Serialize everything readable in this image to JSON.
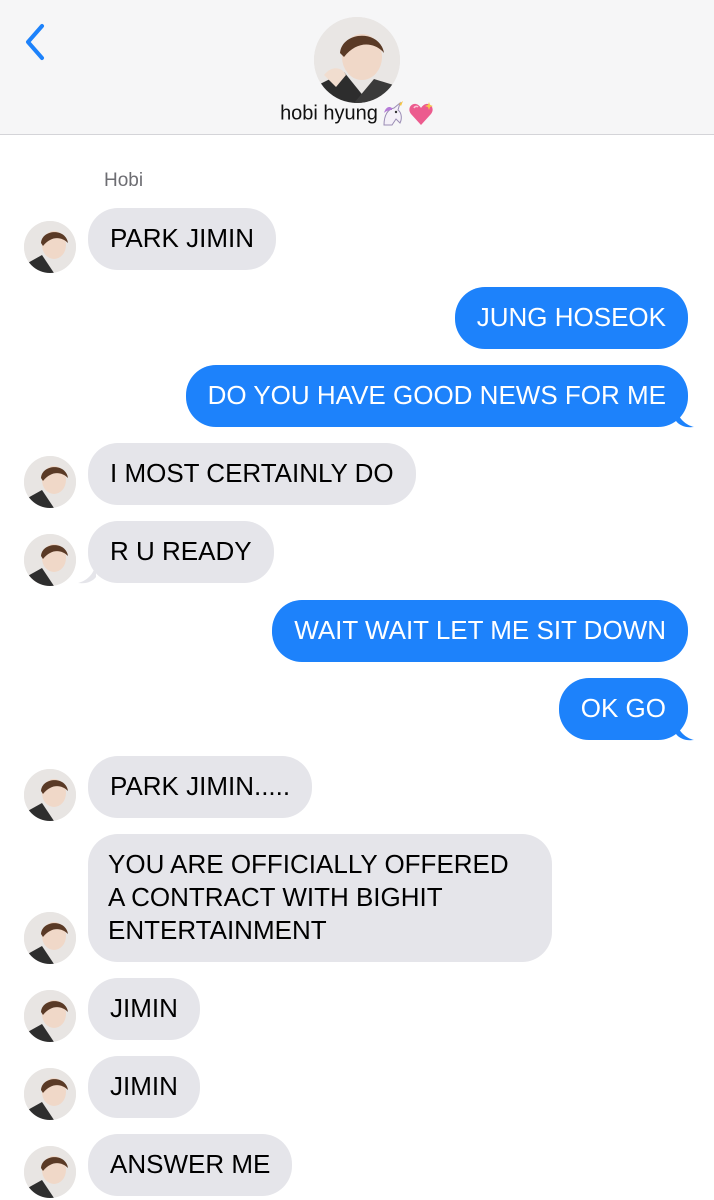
{
  "header": {
    "contact_name": "hobi hyung",
    "emoji_1": "unicorn-icon",
    "emoji_2": "sparkling-heart-icon",
    "back_icon": "chevron-left-icon"
  },
  "thread": {
    "sender_label": "Hobi",
    "messages": [
      {
        "from": "them",
        "text": "PARK JIMIN"
      },
      {
        "from": "me",
        "text": "JUNG HOSEOK"
      },
      {
        "from": "me",
        "text": "DO YOU HAVE GOOD NEWS FOR ME"
      },
      {
        "from": "them",
        "text": "I MOST CERTAINLY DO"
      },
      {
        "from": "them",
        "text": "R U READY"
      },
      {
        "from": "me",
        "text": "WAIT WAIT LET ME SIT DOWN"
      },
      {
        "from": "me",
        "text": "OK GO"
      },
      {
        "from": "them",
        "text": "PARK JIMIN....."
      },
      {
        "from": "them",
        "text": "YOU ARE OFFICIALLY OFFERED A CONTRACT WITH BIGHIT ENTERTAINMENT"
      },
      {
        "from": "them",
        "text": "JIMIN"
      },
      {
        "from": "them",
        "text": "JIMIN"
      },
      {
        "from": "them",
        "text": "ANSWER ME"
      }
    ]
  },
  "colors": {
    "outgoing_bubble": "#1d82fb",
    "incoming_bubble": "#e5e5ea",
    "accent": "#1d82fb"
  }
}
